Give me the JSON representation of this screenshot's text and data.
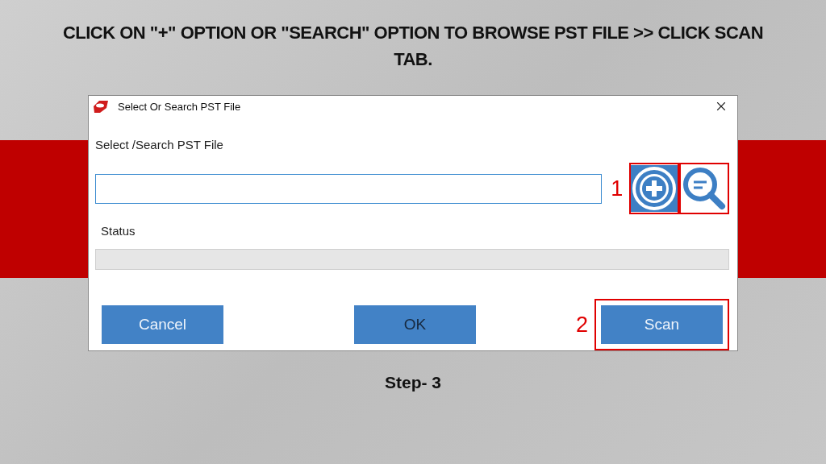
{
  "instruction": "CLICK ON \"+\" OPTION OR \"SEARCH\" OPTION TO BROWSE PST FILE >> CLICK SCAN TAB.",
  "dialog": {
    "title": "Select Or Search PST File",
    "file_label": "Select /Search PST File",
    "file_marker": "1",
    "icon_buttons": [
      {
        "kind": "add",
        "highlighted": true
      },
      {
        "kind": "search",
        "highlighted": true
      }
    ],
    "status_label": "Status",
    "scan_marker": "2",
    "buttons": [
      {
        "label": "Cancel",
        "highlighted": false,
        "focused": false
      },
      {
        "label": "OK",
        "highlighted": false,
        "focused": true
      },
      {
        "label": "Scan",
        "highlighted": true,
        "focused": false
      }
    ]
  },
  "step": "Step- 3"
}
